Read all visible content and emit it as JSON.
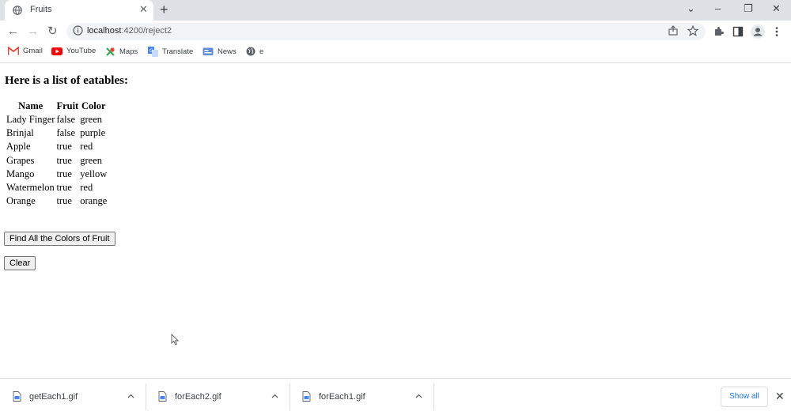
{
  "browser": {
    "tab": {
      "title": "Fruits",
      "close": "✕"
    },
    "new_tab": "+",
    "window": {
      "chevron": "⌄",
      "minimize": "–",
      "restore": "❐",
      "close": "✕"
    },
    "nav": {
      "back": "←",
      "forward": "→",
      "reload": "↻"
    },
    "url": {
      "host": "localhost",
      "path": ":4200/reject2"
    },
    "bookmarks": [
      {
        "label": "Gmail",
        "icon": "gmail-icon"
      },
      {
        "label": "YouTube",
        "icon": "youtube-icon"
      },
      {
        "label": "Maps",
        "icon": "maps-icon"
      },
      {
        "label": "Translate",
        "icon": "translate-icon"
      },
      {
        "label": "News",
        "icon": "news-icon"
      },
      {
        "label": "e",
        "icon": "globe-icon"
      }
    ]
  },
  "page": {
    "heading": "Here is a list of eatables:",
    "table": {
      "headers": [
        "Name",
        "Fruit",
        "Color"
      ],
      "rows": [
        [
          "Lady Finger",
          "false",
          "green"
        ],
        [
          "Brinjal",
          "false",
          "purple"
        ],
        [
          "Apple",
          "true",
          "red"
        ],
        [
          "Grapes",
          "true",
          "green"
        ],
        [
          "Mango",
          "true",
          "yellow"
        ],
        [
          "Watermelon",
          "true",
          "red"
        ],
        [
          "Orange",
          "true",
          "orange"
        ]
      ]
    },
    "find_button": "Find All the Colors of Fruit",
    "clear_button": "Clear"
  },
  "downloads": {
    "items": [
      "getEach1.gif",
      "forEach2.gif",
      "forEach1.gif"
    ],
    "show_all": "Show all",
    "close": "✕"
  },
  "colors": {
    "tabstrip": "#dee1e6",
    "link": "#1a73e8",
    "gmail_red": "#ea4335",
    "youtube_red": "#ff0000"
  }
}
